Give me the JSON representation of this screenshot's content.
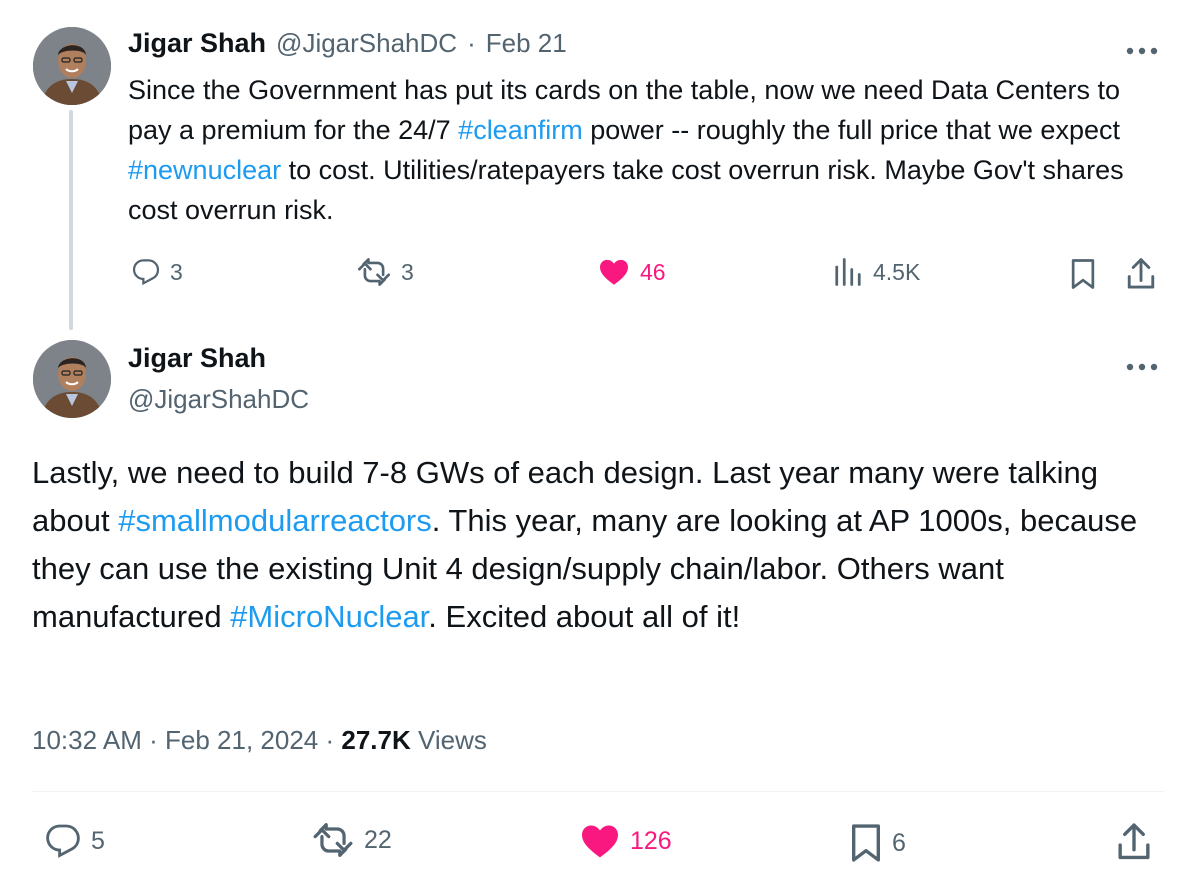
{
  "tweet1": {
    "name": "Jigar Shah",
    "handle": "@JigarShahDC",
    "sep": "·",
    "date": "Feb 21",
    "text_parts": [
      {
        "t": "Since the Government has put its cards on the table, now we need Data Centers to pay a premium for the 24/7 ",
        "tag": false
      },
      {
        "t": "#cleanfirm",
        "tag": true
      },
      {
        "t": " power -- roughly the full price that we expect ",
        "tag": false
      },
      {
        "t": "#newnuclear",
        "tag": true
      },
      {
        "t": " to cost. Utilities/ratepayers take cost overrun risk. Maybe Gov't shares cost overrun risk.",
        "tag": false
      }
    ],
    "replies": "3",
    "retweets": "3",
    "likes": "46",
    "views": "4.5K"
  },
  "tweet2": {
    "name": "Jigar Shah",
    "handle": "@JigarShahDC",
    "text_parts": [
      {
        "t": "Lastly, we need to build 7-8 GWs of each design. Last year many were talking about ",
        "tag": false
      },
      {
        "t": "#smallmodularreactors",
        "tag": true
      },
      {
        "t": ". This year, many are looking at AP 1000s, because they can use the existing Unit 4 design/supply chain/labor. Others want manufactured ",
        "tag": false
      },
      {
        "t": "#MicroNuclear",
        "tag": true
      },
      {
        "t": ". Excited about all of it!",
        "tag": false
      }
    ],
    "time": "10:32 AM",
    "sep": "·",
    "date": "Feb 21, 2024",
    "views_count": "27.7K",
    "views_label": "Views",
    "replies": "5",
    "retweets": "22",
    "likes": "126",
    "bookmarks": "6"
  },
  "colors": {
    "link": "#1d9bf0",
    "like": "#f91880",
    "muted": "#536471",
    "text": "#0f1419"
  },
  "icons": [
    "more-icon",
    "reply-icon",
    "retweet-icon",
    "like-icon",
    "views-icon",
    "bookmark-icon",
    "share-icon"
  ]
}
